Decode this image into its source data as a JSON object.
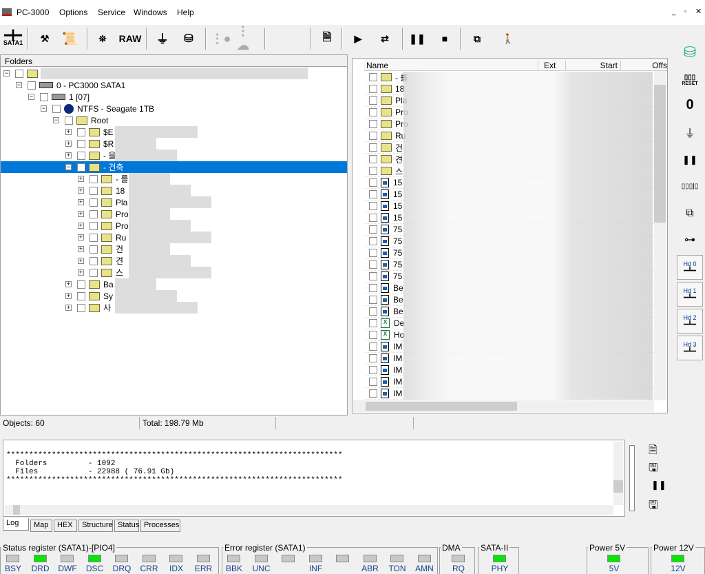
{
  "app": {
    "title": "PC-3000",
    "menu": [
      "Options",
      "Service",
      "Windows",
      "Help"
    ]
  },
  "toolbar": {
    "sata_label": "SATA1",
    "raw_label": "RAW",
    "icons": [
      "sata-port-icon",
      "tools-icon",
      "info-scroll-icon",
      "binoculars-icon",
      "raw-icon",
      "filter-icon",
      "disk-export-icon",
      "tree-icon",
      "tree-cloud-icon",
      "copy-check-icon",
      "play-icon",
      "move-icon",
      "pause-icon",
      "stop-icon",
      "copy-windows-icon",
      "exit-icon"
    ]
  },
  "folders": {
    "header": "Folders",
    "tree": [
      {
        "label": "",
        "level": 0
      },
      {
        "label": "0 - PC3000 SATA1",
        "level": 1
      },
      {
        "label": "1 [07]",
        "level": 2
      },
      {
        "label": "NTFS - Seagate 1TB",
        "level": 3
      },
      {
        "label": "Root",
        "level": 4
      },
      {
        "label": "$E",
        "level": 5
      },
      {
        "label": "$R",
        "level": 5
      },
      {
        "label": "- 을",
        "level": 5
      },
      {
        "label": "- 건축",
        "level": 5,
        "selected": true
      },
      {
        "label": "- 를",
        "level": 6
      },
      {
        "label": "18",
        "level": 6
      },
      {
        "label": "Pla",
        "level": 6
      },
      {
        "label": "Pro",
        "level": 6
      },
      {
        "label": "Pro",
        "level": 6
      },
      {
        "label": "Ru",
        "level": 6
      },
      {
        "label": "건",
        "level": 6
      },
      {
        "label": "견",
        "level": 6
      },
      {
        "label": "스",
        "level": 6
      },
      {
        "label": "Ba",
        "level": 5
      },
      {
        "label": "Sy",
        "level": 5
      },
      {
        "label": "사",
        "level": 5
      }
    ]
  },
  "files": {
    "columns": [
      "Name",
      "Ext",
      "Start",
      "Offs"
    ],
    "rows": [
      {
        "name": "- 를",
        "type": "folder"
      },
      {
        "name": "18",
        "type": "folder"
      },
      {
        "name": "Pla",
        "type": "folder"
      },
      {
        "name": "Pro",
        "type": "folder"
      },
      {
        "name": "Pro",
        "type": "folder"
      },
      {
        "name": "Ru",
        "type": "folder"
      },
      {
        "name": "건",
        "type": "folder"
      },
      {
        "name": "견",
        "type": "folder"
      },
      {
        "name": "스",
        "type": "folder"
      },
      {
        "name": "15",
        "type": "image"
      },
      {
        "name": "15",
        "type": "image"
      },
      {
        "name": "15",
        "type": "image"
      },
      {
        "name": "15",
        "type": "image"
      },
      {
        "name": "75",
        "type": "image"
      },
      {
        "name": "75",
        "type": "image"
      },
      {
        "name": "75",
        "type": "image"
      },
      {
        "name": "75",
        "type": "image"
      },
      {
        "name": "75",
        "type": "image"
      },
      {
        "name": "Be",
        "type": "image"
      },
      {
        "name": "Be",
        "type": "image"
      },
      {
        "name": "Be",
        "type": "image"
      },
      {
        "name": "De",
        "type": "excel"
      },
      {
        "name": "Ho",
        "type": "excel"
      },
      {
        "name": "IM",
        "type": "image"
      },
      {
        "name": "IM",
        "type": "image"
      },
      {
        "name": "IM",
        "type": "image"
      },
      {
        "name": "IM",
        "type": "image"
      },
      {
        "name": "IM",
        "type": "image"
      }
    ]
  },
  "statusbar": {
    "objects": "Objects: 60",
    "total": "Total: 198.79 Mb"
  },
  "log": {
    "lines": [
      "**************************************************************************",
      "  Folders         - 1092",
      "  Files           - 22988 ( 76.91 Gb)",
      "**************************************************************************"
    ]
  },
  "tabs": [
    "Log",
    "Map",
    "HEX",
    "Structure",
    "Status",
    "Processes"
  ],
  "right_toolbar": {
    "reset_label": "RESET",
    "hd": [
      "Hd 0",
      "Hd 1",
      "Hd 2",
      "Hd 3"
    ]
  },
  "registers": {
    "status": {
      "title": "Status register (SATA1)-[PIO4]",
      "leds": [
        {
          "l": "BSY",
          "on": false
        },
        {
          "l": "DRD",
          "on": true
        },
        {
          "l": "DWF",
          "on": false
        },
        {
          "l": "DSC",
          "on": true
        },
        {
          "l": "DRQ",
          "on": false
        },
        {
          "l": "CRR",
          "on": false
        },
        {
          "l": "IDX",
          "on": false
        },
        {
          "l": "ERR",
          "on": false
        }
      ]
    },
    "error": {
      "title": "Error register (SATA1)",
      "leds": [
        {
          "l": "BBK",
          "on": false
        },
        {
          "l": "UNC",
          "on": false
        },
        {
          "l": "",
          "on": false
        },
        {
          "l": "INF",
          "on": false
        },
        {
          "l": "",
          "on": false
        },
        {
          "l": "ABR",
          "on": false
        },
        {
          "l": "TON",
          "on": false
        },
        {
          "l": "AMN",
          "on": false
        }
      ]
    },
    "dma": {
      "title": "DMA",
      "leds": [
        {
          "l": "RQ",
          "on": false
        }
      ]
    },
    "sata2": {
      "title": "SATA-II",
      "leds": [
        {
          "l": "PHY",
          "on": true
        }
      ]
    },
    "p5": {
      "title": "Power 5V",
      "leds": [
        {
          "l": "5V",
          "on": true
        }
      ]
    },
    "p12": {
      "title": "Power 12V",
      "leds": [
        {
          "l": "12V",
          "on": true
        }
      ]
    }
  },
  "colors": {
    "selection": "#0078d7",
    "led_on": "#0be30b",
    "led_off": "#c8c8c8"
  }
}
